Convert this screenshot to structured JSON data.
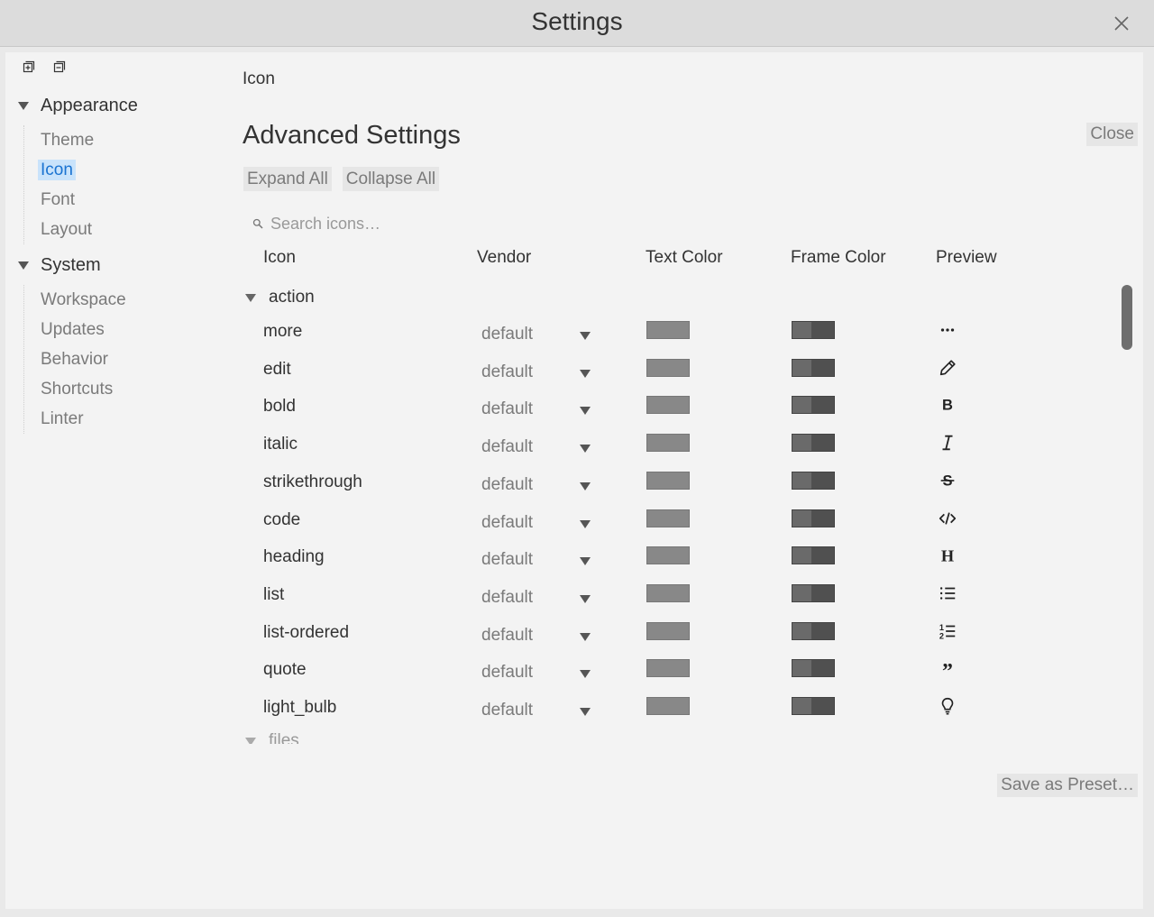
{
  "window": {
    "title": "Settings"
  },
  "sidebar": {
    "groups": [
      {
        "label": "Appearance",
        "items": [
          "Theme",
          "Icon",
          "Font",
          "Layout"
        ]
      },
      {
        "label": "System",
        "items": [
          "Workspace",
          "Updates",
          "Behavior",
          "Shortcuts",
          "Linter"
        ]
      }
    ],
    "active_item": "Icon"
  },
  "main": {
    "breadcrumb": "Icon",
    "heading": "Advanced Settings",
    "close_label": "Close",
    "expand_all": "Expand All",
    "collapse_all": "Collapse All",
    "search_placeholder": "Search icons…",
    "columns": [
      "Icon",
      "Vendor",
      "Text Color",
      "Frame Color",
      "Preview"
    ],
    "categories": [
      {
        "name": "action",
        "rows": [
          {
            "name": "more",
            "vendor": "default",
            "preview_icon": "more-icon"
          },
          {
            "name": "edit",
            "vendor": "default",
            "preview_icon": "pencil-icon"
          },
          {
            "name": "bold",
            "vendor": "default",
            "preview_icon": "bold-icon"
          },
          {
            "name": "italic",
            "vendor": "default",
            "preview_icon": "italic-icon"
          },
          {
            "name": "strikethrough",
            "vendor": "default",
            "preview_icon": "strikethrough-icon"
          },
          {
            "name": "code",
            "vendor": "default",
            "preview_icon": "code-icon"
          },
          {
            "name": "heading",
            "vendor": "default",
            "preview_icon": "heading-icon"
          },
          {
            "name": "list",
            "vendor": "default",
            "preview_icon": "list-icon"
          },
          {
            "name": "list-ordered",
            "vendor": "default",
            "preview_icon": "list-ordered-icon"
          },
          {
            "name": "quote",
            "vendor": "default",
            "preview_icon": "quote-icon"
          },
          {
            "name": "light_bulb",
            "vendor": "default",
            "preview_icon": "light-bulb-icon"
          }
        ]
      },
      {
        "name": "files",
        "rows": []
      }
    ],
    "save_preset": "Save as Preset…"
  },
  "colors": {
    "text_swatch": "#888888",
    "frame_swatch_dark": "#505050",
    "frame_swatch_light": "#6a6a6a",
    "active_bg": "#c9e3fb",
    "active_text": "#1a73d1",
    "scrollbar": "#6e6e6e"
  }
}
